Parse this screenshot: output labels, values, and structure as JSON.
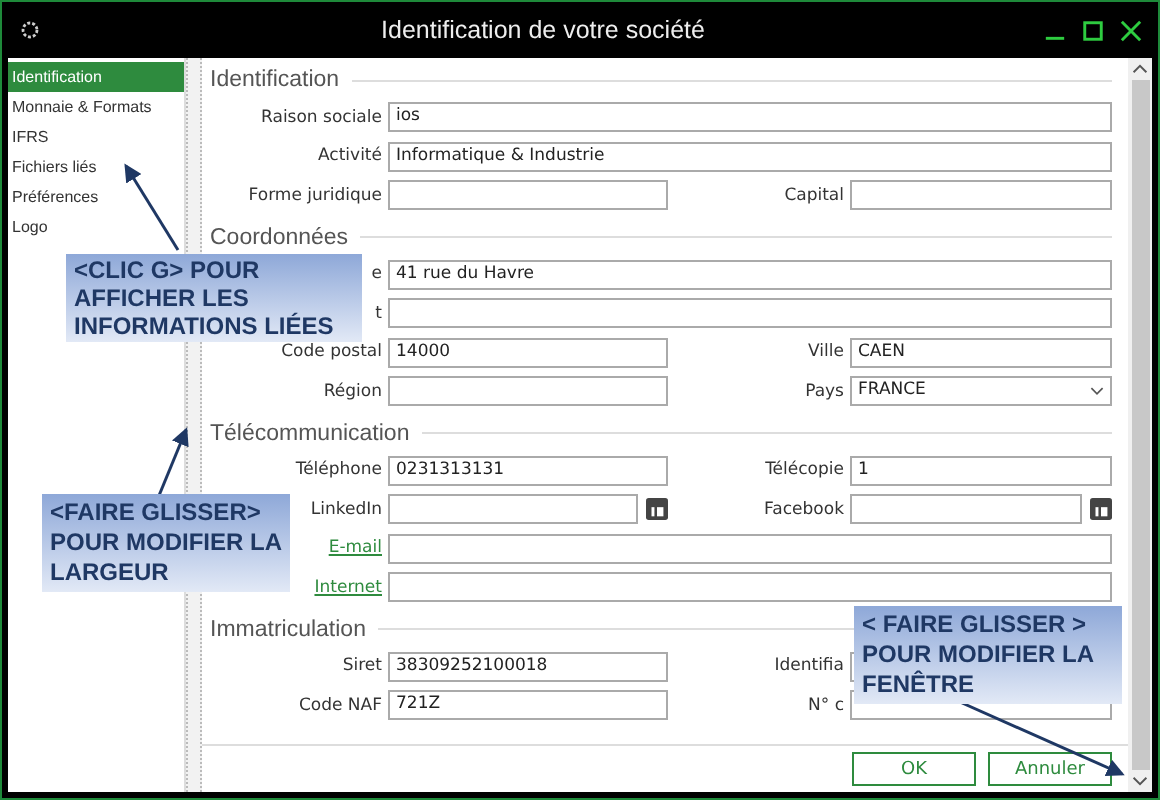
{
  "window": {
    "title": "Identification de votre société"
  },
  "sidebar": {
    "items": [
      {
        "label": "Identification",
        "selected": true
      },
      {
        "label": "Monnaie & Formats",
        "selected": false
      },
      {
        "label": "IFRS",
        "selected": false
      },
      {
        "label": "Fichiers liés",
        "selected": false
      },
      {
        "label": "Préférences",
        "selected": false
      },
      {
        "label": "Logo",
        "selected": false
      }
    ]
  },
  "sections": [
    {
      "title": "Identification",
      "rows": [
        {
          "left": {
            "label": "Raison sociale",
            "value": "ios",
            "kind": "text"
          }
        },
        {
          "left": {
            "label": "Activité",
            "value": "Informatique & Industrie",
            "kind": "text"
          }
        },
        {
          "left": {
            "label": "Forme juridique",
            "kind": "text"
          },
          "right": {
            "label": "Capital",
            "kind": "text"
          }
        }
      ]
    },
    {
      "title": "Coordonnées",
      "rows": [
        {
          "left": {
            "label": "e",
            "value": "41 rue du Havre",
            "kind": "text"
          }
        },
        {
          "left": {
            "label": "t",
            "kind": "text"
          }
        },
        {
          "left": {
            "label": "Code postal",
            "value": "14000",
            "kind": "text"
          },
          "right": {
            "label": "Ville",
            "value": "CAEN",
            "kind": "text"
          }
        },
        {
          "left": {
            "label": "Région",
            "kind": "text"
          },
          "right": {
            "label": "Pays",
            "value": "FRANCE",
            "kind": "select"
          }
        }
      ]
    },
    {
      "title": "Télécommunication",
      "rows": [
        {
          "left": {
            "label": "Téléphone",
            "value": "0231313131",
            "kind": "text"
          },
          "right": {
            "label": "Télécopie",
            "value": "1",
            "kind": "text"
          }
        },
        {
          "left": {
            "label": "LinkedIn",
            "kind": "social"
          },
          "right": {
            "label": "Facebook",
            "kind": "social"
          }
        },
        {
          "left": {
            "label": "E-mail",
            "kind": "link"
          }
        },
        {
          "left": {
            "label": "Internet",
            "kind": "link"
          }
        }
      ]
    },
    {
      "title": "Immatriculation",
      "rows": [
        {
          "left": {
            "label": "Siret",
            "value": "38309252100018",
            "kind": "text"
          },
          "right": {
            "label": "Identifia",
            "kind": "text"
          }
        },
        {
          "left": {
            "label": "Code NAF",
            "value": "721Z",
            "kind": "text"
          },
          "right": {
            "label": "N° c",
            "kind": "text"
          }
        }
      ]
    }
  ],
  "buttons": [
    {
      "label": "OK"
    },
    {
      "label": "Annuler"
    }
  ],
  "callouts": [
    {
      "lines": [
        "<CLIC G> POUR",
        "AFFICHER LES",
        "INFORMATIONS LIÉES"
      ]
    },
    {
      "lines": [
        "<FAIRE GLISSER>",
        "POUR MODIFIER LA",
        "LARGEUR"
      ]
    },
    {
      "lines": [
        "< FAIRE GLISSER >",
        "POUR MODIFIER LA",
        "FENÊTRE"
      ]
    }
  ]
}
